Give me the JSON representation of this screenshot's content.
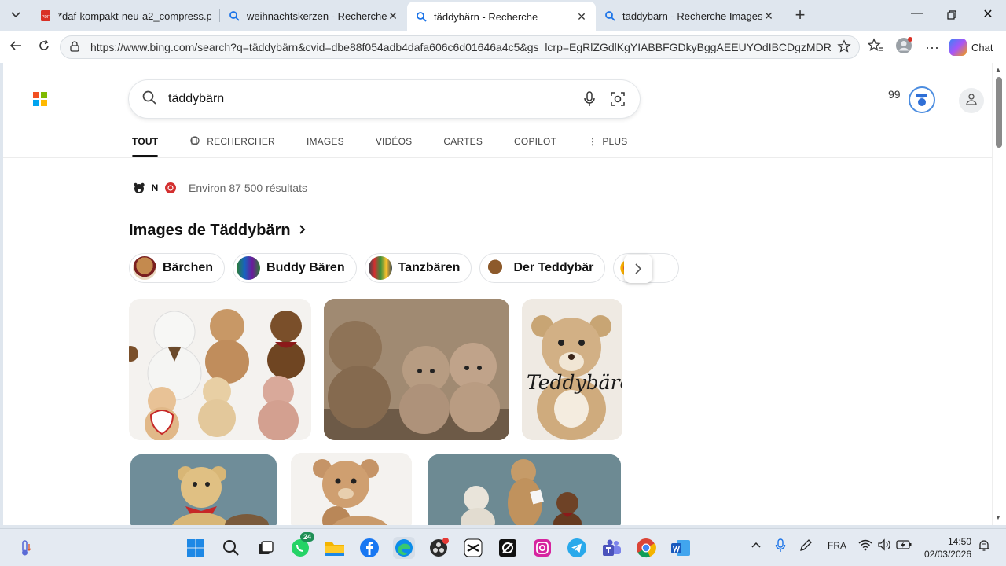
{
  "browser": {
    "tabs": [
      {
        "title": "*daf-kompakt-neu-a2_compress.p",
        "icon": "pdf-icon",
        "active": false
      },
      {
        "title": "weihnachtskerzen - Recherche",
        "icon": "search-icon",
        "active": false
      },
      {
        "title": "täddybärn - Recherche",
        "icon": "search-icon",
        "active": true
      },
      {
        "title": "täddybärn - Recherche Images",
        "icon": "search-icon",
        "active": false
      }
    ],
    "url": "https://www.bing.com/search?q=täddybärn&cvid=dbe88f054adb4dafa606c6d01646a4c5&gs_lcrp=EgRlZGdlKgYIABBFGDkyBggAEEUYOdIBCDgzMDRq...",
    "chat_label": "Chat"
  },
  "bing": {
    "query": "täddybärn",
    "rewards_points": "99",
    "scopes": [
      "TOUT",
      "RECHERCHER",
      "IMAGES",
      "VIDÉOS",
      "CARTES",
      "COPILOT",
      "PLUS"
    ],
    "results_count": "Environ 87 500 résultats",
    "images_heading": "Images de Täddybärn",
    "chips": [
      "Bärchen",
      "Buddy Bären",
      "Tanzbären",
      "Der Teddybär"
    ],
    "tile_overlay_text": "Teddybären"
  },
  "taskbar": {
    "whatsapp_badge": "24",
    "language": "FRA",
    "time": "14:50",
    "date": "02/03/2026"
  },
  "colors": {
    "accent": "#0078d4",
    "tab_strip": "#dfe6ee",
    "taskbar": "#e4eaf2"
  }
}
